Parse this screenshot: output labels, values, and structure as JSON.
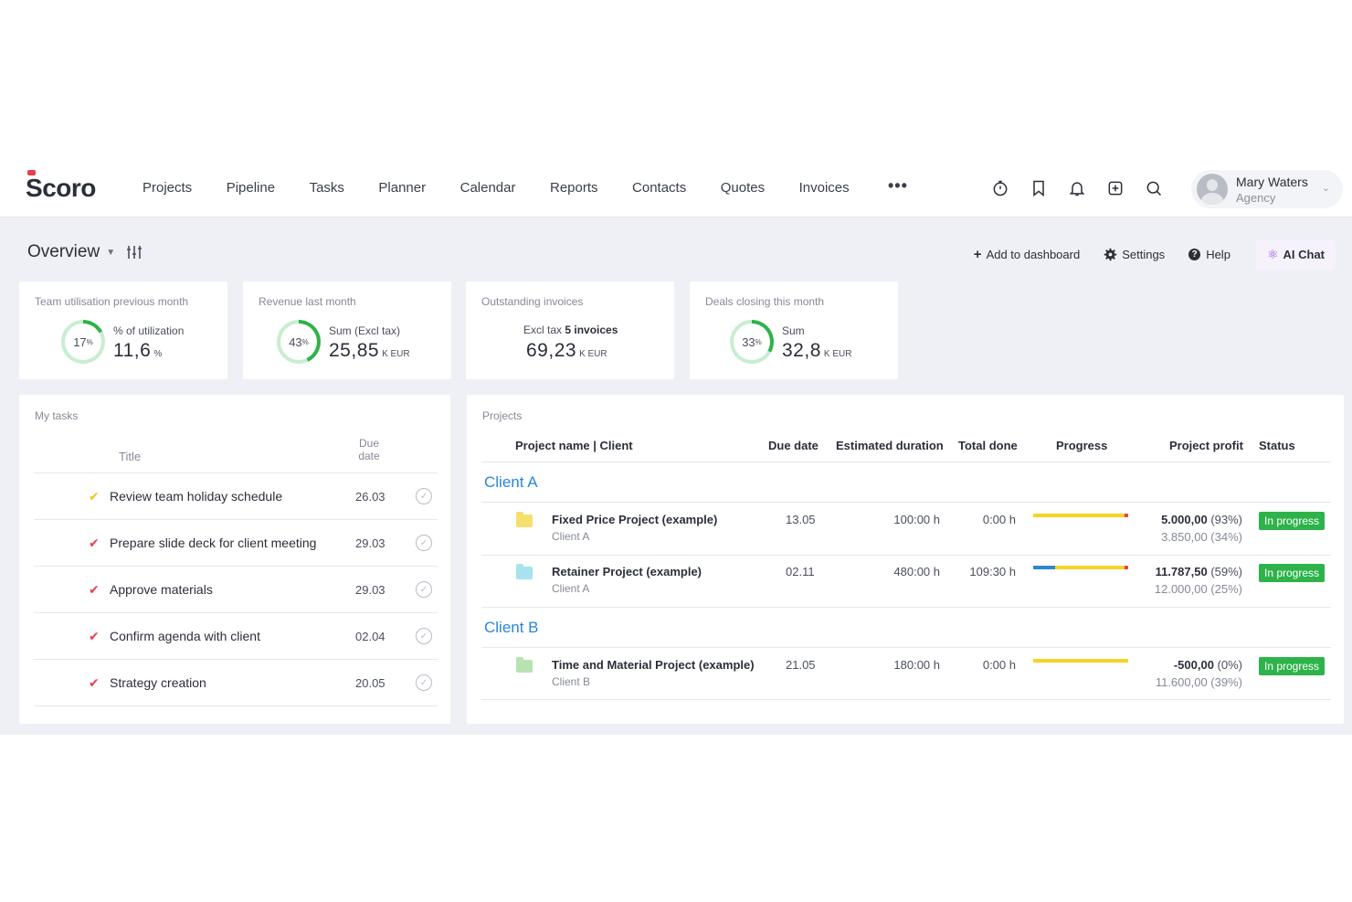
{
  "brand": {
    "logo_text": "Scoro",
    "accent": "#e8404d"
  },
  "nav": {
    "items": [
      "Projects",
      "Pipeline",
      "Tasks",
      "Planner",
      "Calendar",
      "Reports",
      "Contacts",
      "Quotes",
      "Invoices"
    ],
    "more": "•••"
  },
  "top_icons": [
    "timer-icon",
    "bookmark-icon",
    "bell-icon",
    "add-square-icon",
    "search-icon"
  ],
  "user": {
    "name": "Mary Waters",
    "org": "Agency"
  },
  "overview": {
    "title": "Overview",
    "actions": {
      "add": "Add to dashboard",
      "settings": "Settings",
      "help": "Help",
      "ai": "AI Chat"
    }
  },
  "kpis": [
    {
      "title": "Team utilisation previous month",
      "percent": 17,
      "pct_label": "17",
      "sub": "% of utilization",
      "value": "11,6",
      "unit": "%"
    },
    {
      "title": "Revenue last month",
      "percent": 43,
      "pct_label": "43",
      "sub": "Sum (Excl tax)",
      "value": "25,85",
      "unit": "K EUR"
    },
    {
      "title": "Outstanding invoices",
      "sub_prefix": "Excl tax",
      "sub_bold": "5 invoices",
      "value": "69,23",
      "unit": "K EUR"
    },
    {
      "title": "Deals closing this month",
      "percent": 33,
      "pct_label": "33",
      "sub": "Sum",
      "value": "32,8",
      "unit": "K EUR"
    }
  ],
  "tasks": {
    "title": "My tasks",
    "col_title": "Title",
    "col_due": "Due date",
    "rows": [
      {
        "title": "Review team holiday schedule",
        "due": "26.03",
        "check_color": "#f5c518"
      },
      {
        "title": "Prepare slide deck for client meeting",
        "due": "29.03",
        "check_color": "#e8404d"
      },
      {
        "title": "Approve materials",
        "due": "29.03",
        "check_color": "#e8404d"
      },
      {
        "title": "Confirm agenda with client",
        "due": "02.04",
        "check_color": "#e8404d"
      },
      {
        "title": "Strategy creation",
        "due": "20.05",
        "check_color": "#e8404d"
      }
    ]
  },
  "projects": {
    "title": "Projects",
    "columns": {
      "name": "Project name | Client",
      "due": "Due date",
      "duration": "Estimated duration",
      "done": "Total done",
      "progress": "Progress",
      "profit": "Project profit",
      "status": "Status"
    },
    "groups": [
      {
        "label": "Client A",
        "rows": [
          {
            "name": "Fixed Price Project (example)",
            "client": "Client A",
            "due": "13.05",
            "duration": "100:00 h",
            "done": "0:00 h",
            "progress_done": 0,
            "over": true,
            "profit": "5.000,00",
            "profit_pct": "(93%)",
            "profit2": "3.850,00 (34%)",
            "status": "In progress",
            "folder_color": "#f7df6e"
          },
          {
            "name": "Retainer Project (example)",
            "client": "Client A",
            "due": "02.11",
            "duration": "480:00 h",
            "done": "109:30 h",
            "progress_done": 0.23,
            "over": true,
            "profit": "11.787,50",
            "profit_pct": "(59%)",
            "profit2": "12.000,00 (25%)",
            "status": "In progress",
            "folder_color": "#a7e2ee"
          }
        ]
      },
      {
        "label": "Client B",
        "rows": [
          {
            "name": "Time and Material Project (example)",
            "client": "Client B",
            "due": "21.05",
            "duration": "180:00 h",
            "done": "0:00 h",
            "progress_done": 0,
            "over": false,
            "profit": "-500,00",
            "profit_pct": "(0%)",
            "profit2": "11.600,00 (39%)",
            "status": "In progress",
            "folder_color": "#b6e3b0"
          }
        ]
      }
    ]
  }
}
